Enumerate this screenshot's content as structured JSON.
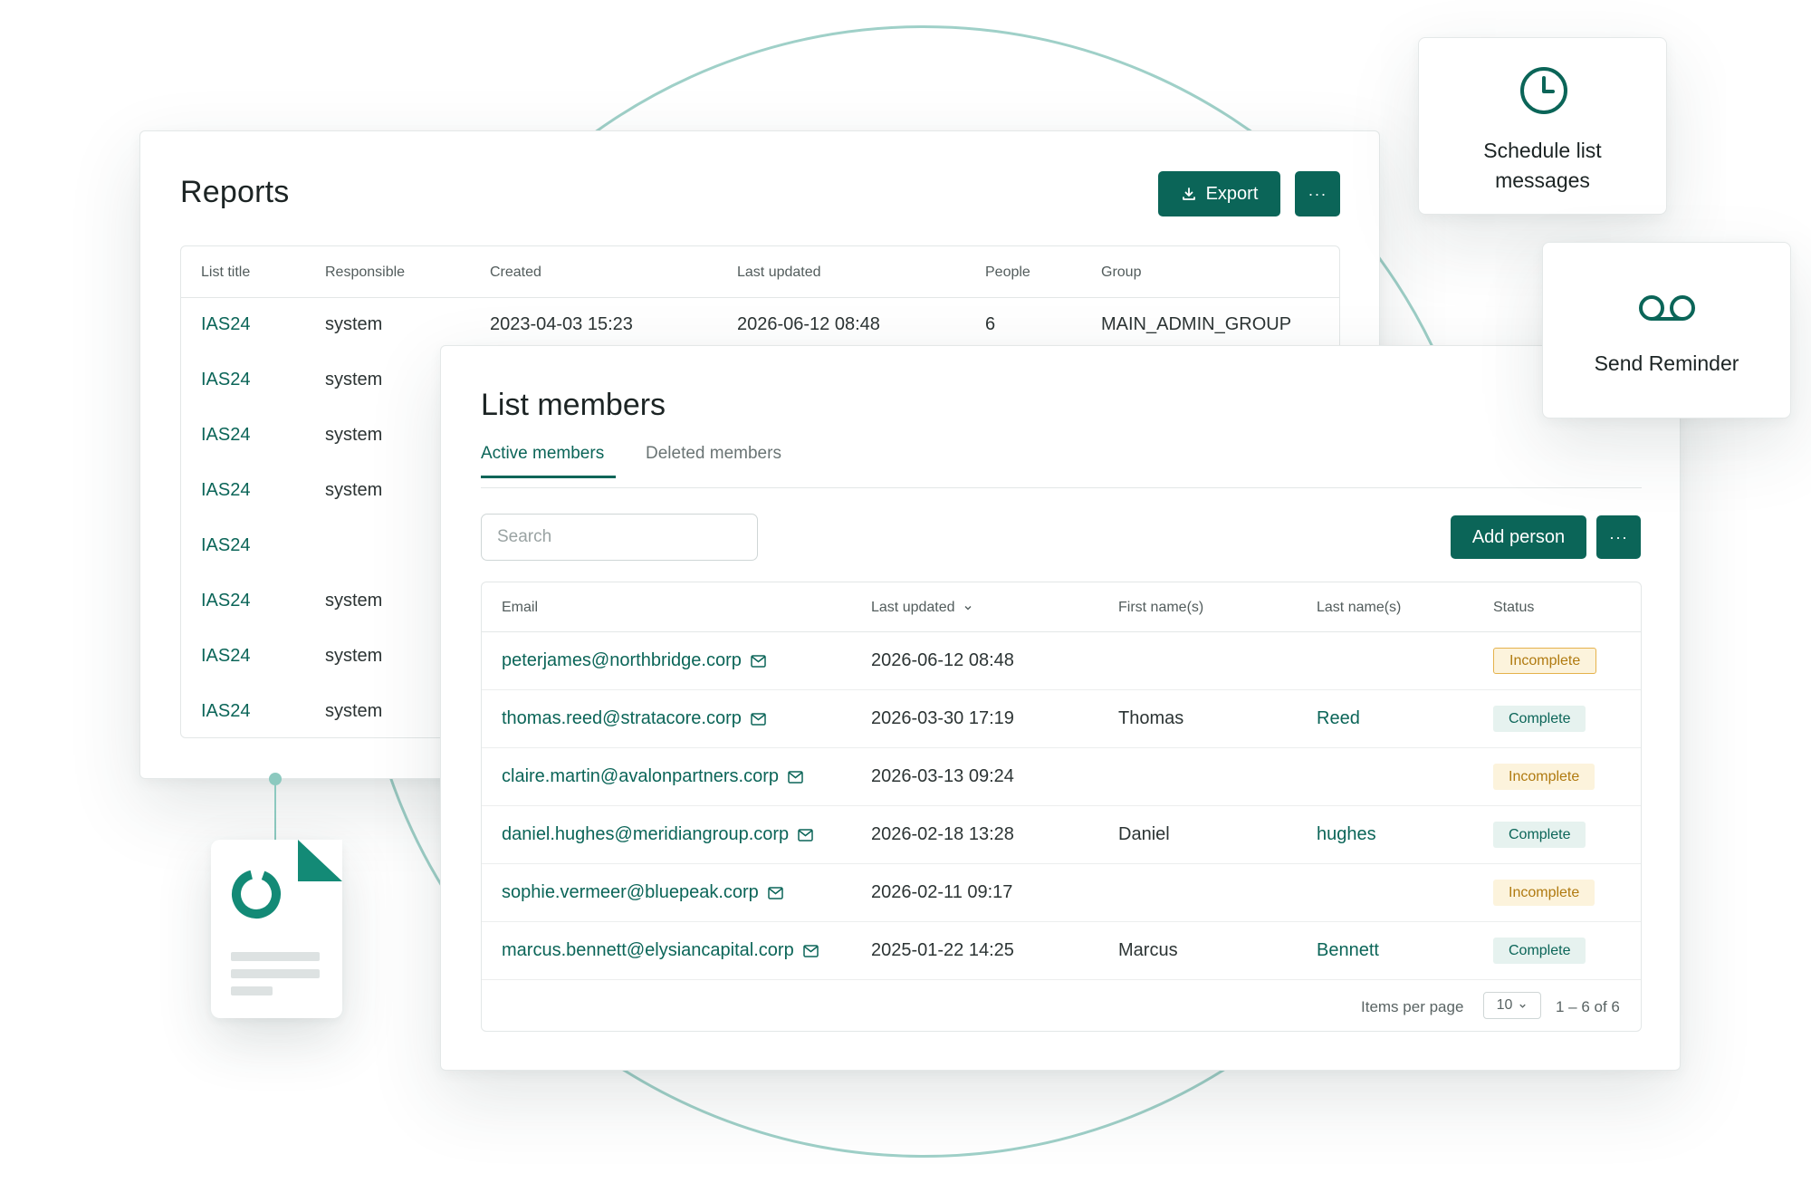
{
  "reports": {
    "title": "Reports",
    "export_label": "Export",
    "more_label": "···",
    "columns": [
      "List title",
      "Responsible",
      "Created",
      "Last updated",
      "People",
      "Group"
    ],
    "rows": [
      {
        "title": "IAS24",
        "responsible": "system",
        "created": "2023-04-03 15:23",
        "updated": "2026-06-12 08:48",
        "people": "6",
        "group": "MAIN_ADMIN_GROUP"
      },
      {
        "title": "IAS24",
        "responsible": "system"
      },
      {
        "title": "IAS24",
        "responsible": "system"
      },
      {
        "title": "IAS24",
        "responsible": "system"
      },
      {
        "title": "IAS24",
        "responsible": ""
      },
      {
        "title": "IAS24",
        "responsible": "system"
      },
      {
        "title": "IAS24",
        "responsible": "system"
      },
      {
        "title": "IAS24",
        "responsible": "system"
      }
    ]
  },
  "members": {
    "title": "List members",
    "tabs": [
      "Active members",
      "Deleted members"
    ],
    "search_placeholder": "Search",
    "add_person_label": "Add person",
    "more_label": "···",
    "columns": [
      "Email",
      "Last updated",
      "First name(s)",
      "Last name(s)",
      "Status"
    ],
    "rows": [
      {
        "email": "peterjames@northbridge.corp",
        "updated": "2026-06-12 08:48",
        "first": "",
        "last": "",
        "status": "Incomplete"
      },
      {
        "email": "thomas.reed@stratacore.corp",
        "updated": "2026-03-30 17:19",
        "first": "Thomas",
        "last": "Reed",
        "status": "Complete"
      },
      {
        "email": "claire.martin@avalonpartners.corp",
        "updated": "2026-03-13 09:24",
        "first": "",
        "last": "",
        "status": "Incomplete"
      },
      {
        "email": "daniel.hughes@meridiangroup.corp",
        "updated": "2026-02-18 13:28",
        "first": "Daniel",
        "last": "hughes",
        "status": "Complete"
      },
      {
        "email": "sophie.vermeer@bluepeak.corp",
        "updated": "2026-02-11 09:17",
        "first": "",
        "last": "",
        "status": "Incomplete"
      },
      {
        "email": "marcus.bennett@elysiancapital.corp",
        "updated": "2025-01-22 14:25",
        "first": "Marcus",
        "last": "Bennett",
        "status": "Complete"
      }
    ],
    "footer": {
      "items_per_page_label": "Items per page",
      "per_page_value": "10",
      "range": "1 – 6 of 6"
    }
  },
  "schedule": {
    "label_line1": "Schedule list",
    "label_line2": "messages",
    "icon": "clock-icon"
  },
  "reminder": {
    "label": "Send Reminder",
    "icon": "voicemail-icon"
  },
  "colors": {
    "accent": "#0b6558",
    "incomplete_bg": "#fcf3dc",
    "incomplete_text": "#b07a10",
    "complete_bg": "#e6f2ef",
    "circle": "#9fd0c8"
  }
}
